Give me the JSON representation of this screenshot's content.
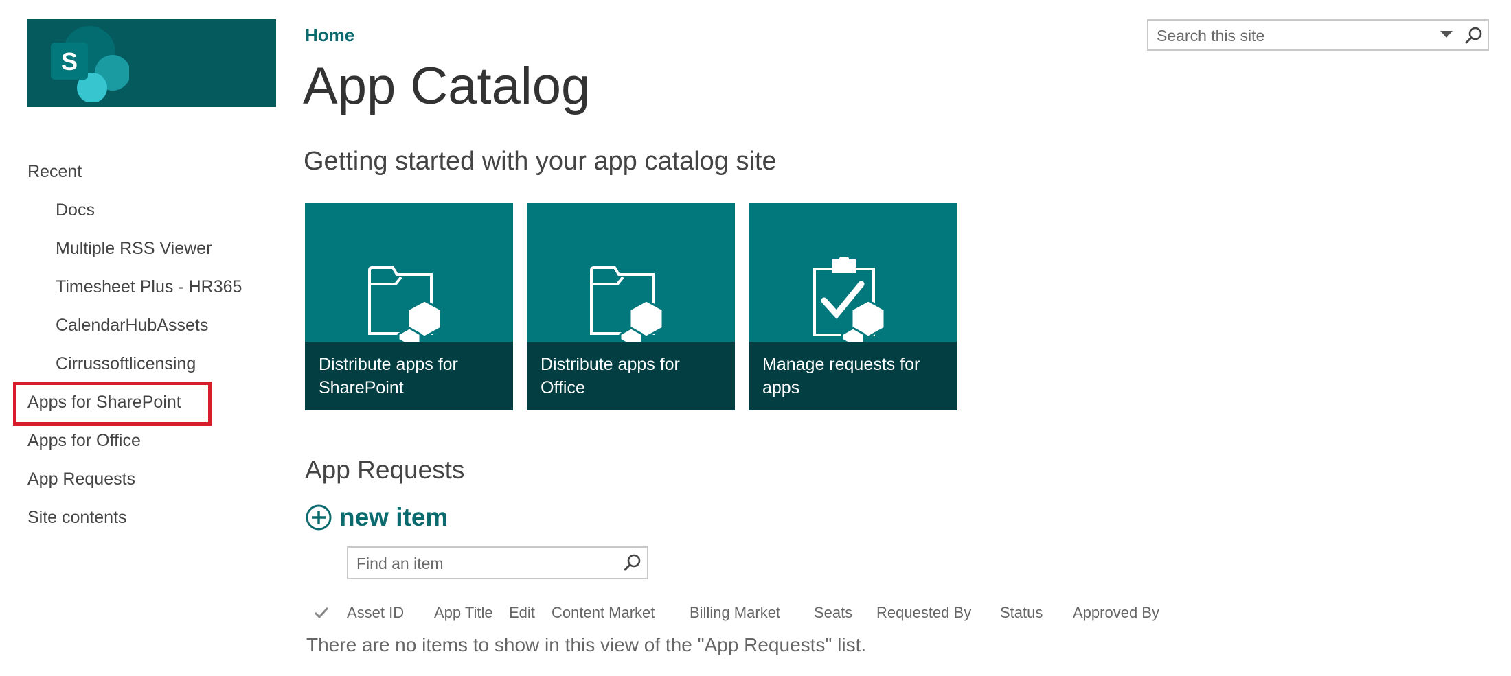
{
  "logo": {
    "letter": "S",
    "icon": "sharepoint-logo-icon"
  },
  "breadcrumb": "Home",
  "page_title": "App Catalog",
  "search": {
    "placeholder": "Search this site"
  },
  "left_nav": {
    "recent_label": "Recent",
    "recent_items": [
      "Docs",
      "Multiple RSS Viewer",
      "Timesheet Plus - HR365",
      "CalendarHubAssets",
      "Cirrussoftlicensing"
    ],
    "items": [
      "Apps for SharePoint",
      "Apps for Office",
      "App Requests",
      "Site contents"
    ]
  },
  "getting_started": {
    "heading": "Getting started with your app catalog site",
    "tiles": [
      {
        "title": "Distribute apps for SharePoint",
        "icon": "folder-app-icon"
      },
      {
        "title": "Distribute apps for Office",
        "icon": "folder-app-icon"
      },
      {
        "title": "Manage requests for apps",
        "icon": "clipboard-check-icon"
      }
    ]
  },
  "app_requests": {
    "heading": "App Requests",
    "new_item_label": "new item",
    "find_placeholder": "Find an item",
    "columns": [
      "Asset ID",
      "App Title",
      "Edit",
      "Content Market",
      "Billing Market",
      "Seats",
      "Requested By",
      "Status",
      "Approved By"
    ],
    "empty_message": "There are no items to show in this view of the \"App Requests\" list."
  },
  "colors": {
    "tile": "#03787c",
    "tile_caption": "#033f42",
    "accent": "#0b6a6e",
    "highlight": "#d71f2b"
  }
}
